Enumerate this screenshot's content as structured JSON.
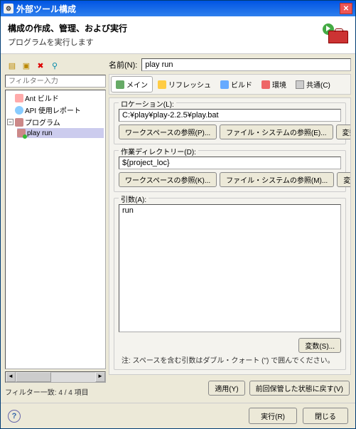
{
  "window": {
    "title": "外部ツール構成"
  },
  "header": {
    "title": "構成の作成、管理、および実行",
    "subtitle": "プログラムを実行します"
  },
  "sidebar": {
    "filter_placeholder": "フィルター入力",
    "tree": {
      "ant": "Ant ビルド",
      "api": "API 使用レポート",
      "program": "プログラム",
      "play_run": "play run"
    },
    "filter_count": "フィルター一致: 4 / 4 項目"
  },
  "form": {
    "name_label": "名前(N):",
    "name_value": "play run",
    "tabs": {
      "main": "メイン",
      "refresh": "リフレッシュ",
      "build": "ビルド",
      "environment": "環境",
      "common": "共通(C)"
    },
    "location": {
      "label": "ロケーション(L):",
      "value": "C:¥play¥play-2.2.5¥play.bat",
      "browse_ws": "ワークスペースの参照(P)...",
      "browse_fs": "ファイル・システムの参照(E)...",
      "vars": "変数(D)..."
    },
    "workdir": {
      "label": "作業ディレクトリー(D):",
      "value": "${project_loc}",
      "browse_ws": "ワークスペースの参照(K)...",
      "browse_fs": "ファイル・システムの参照(M)...",
      "vars": "変数(B)..."
    },
    "args": {
      "label": "引数(A):",
      "value": "run",
      "vars": "変数(S)...",
      "hint": "注: スペースを含む引数はダブル・クォート (\") で囲んでください。"
    },
    "apply": "適用(Y)",
    "revert": "前回保管した状態に戻す(V)"
  },
  "footer": {
    "run": "実行(R)",
    "close": "閉じる"
  }
}
